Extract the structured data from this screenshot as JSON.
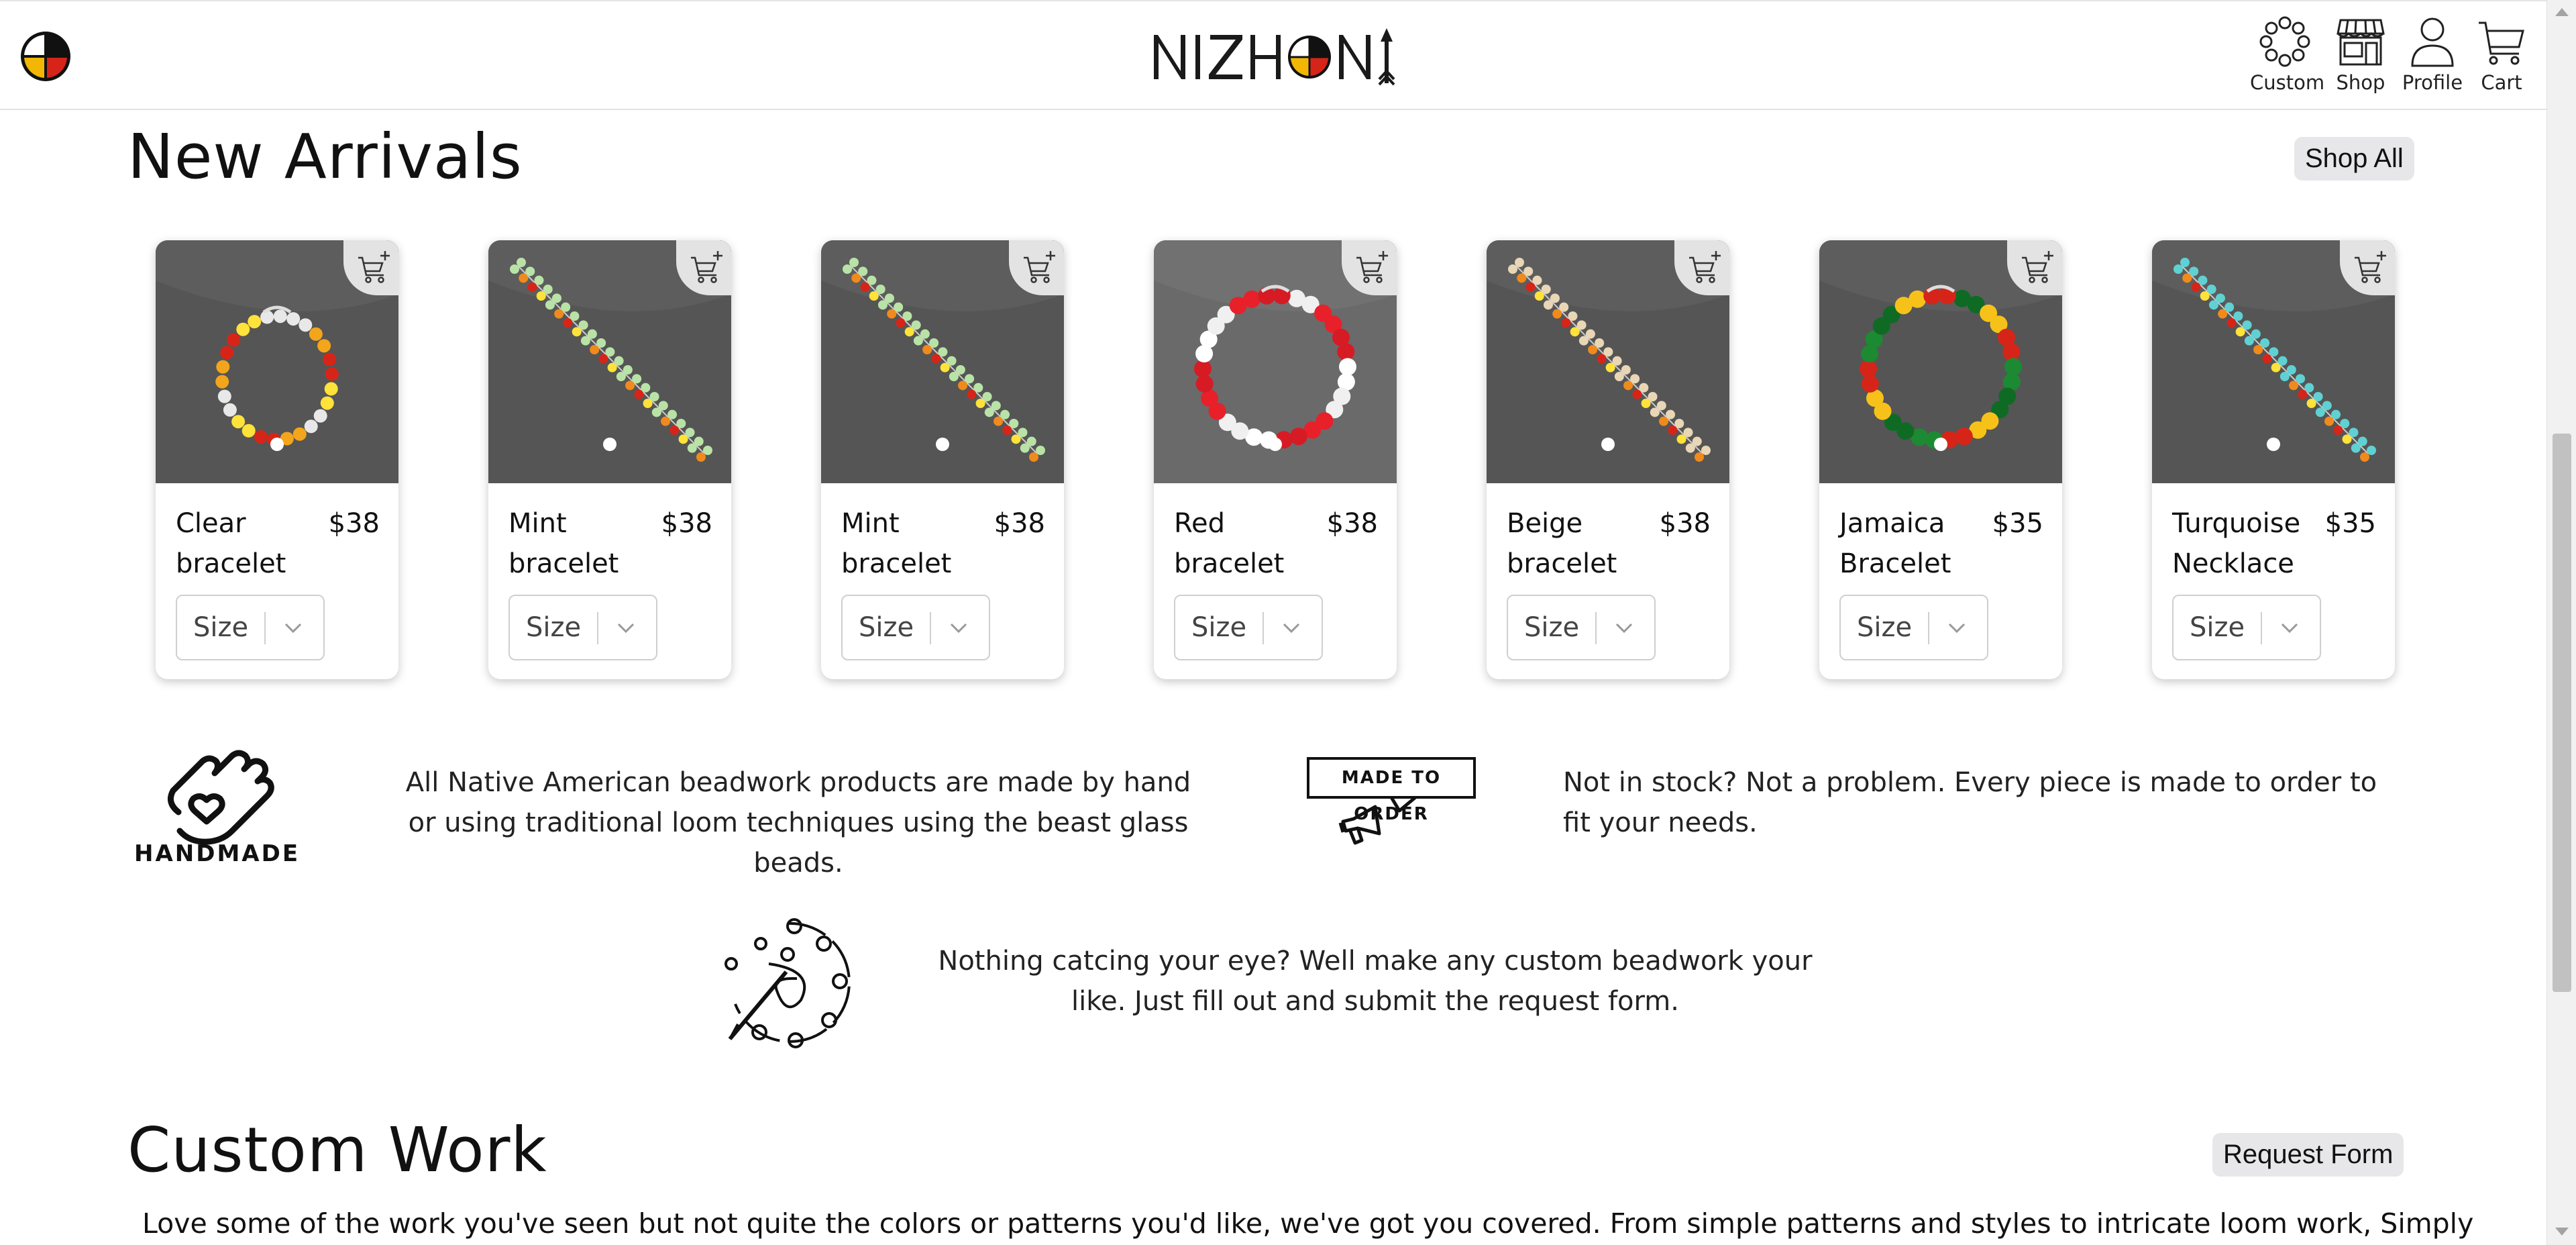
{
  "header": {
    "logo_text": "NIZHONI",
    "nav": [
      {
        "label": "Custom",
        "icon": "beads-circle-icon"
      },
      {
        "label": "Shop",
        "icon": "storefront-icon"
      },
      {
        "label": "Profile",
        "icon": "person-icon"
      },
      {
        "label": "Cart",
        "icon": "cart-icon"
      }
    ]
  },
  "new_arrivals": {
    "title": "New Arrivals",
    "shop_all_label": "Shop All",
    "products": [
      {
        "name": "Clear bracelet",
        "price": "$38",
        "size_placeholder": "Size",
        "image": "round bracelet clear/red/orange/yellow beads"
      },
      {
        "name": "Mint bracelet",
        "price": "$38",
        "size_placeholder": "Size",
        "image": "straight bracelet mint/orange/red beads"
      },
      {
        "name": "Mint bracelet",
        "price": "$38",
        "size_placeholder": "Size",
        "image": "straight bracelet mint/orange/red beads"
      },
      {
        "name": "Red bracelet",
        "price": "$38",
        "size_placeholder": "Size",
        "image": "round bracelet red/white beads"
      },
      {
        "name": "Beige bracelet",
        "price": "$38",
        "size_placeholder": "Size",
        "image": "straight bracelet beige/orange/red beads"
      },
      {
        "name": "Jamaica Bracelet",
        "price": "$35",
        "size_placeholder": "Size",
        "image": "round bracelet green/yellow/red beads"
      },
      {
        "name": "Turquoise Necklace",
        "price": "$35",
        "size_placeholder": "Size",
        "image": "straight turquoise/orange/red beads"
      }
    ]
  },
  "features": {
    "handmade_label": "HANDMADE",
    "handmade_text": "All Native American beadwork products are made by hand or using traditional loom techniques using the beast glass beads.",
    "made_to_order_label": "MADE TO ORDER",
    "made_to_order_text": "Not in stock? Not a problem. Every piece is made to order to fit your needs.",
    "custom_text": "Nothing catcing your eye? Well make any custom beadwork your like. Just fill out and submit the request form."
  },
  "custom_work": {
    "title": "Custom Work",
    "request_form_label": "Request Form",
    "description": "Love some of the work you've seen but not quite the colors or patterns you'd like, we've got you covered. From simple patterns and styles to intricate loom work, Simply"
  },
  "colors": {
    "wheel_black": "#111111",
    "wheel_white": "#ffffff",
    "wheel_yellow": "#f2b705",
    "wheel_red": "#d62518",
    "card_bg": "#5b5b5b",
    "pill_bg": "#e7e7ea"
  }
}
